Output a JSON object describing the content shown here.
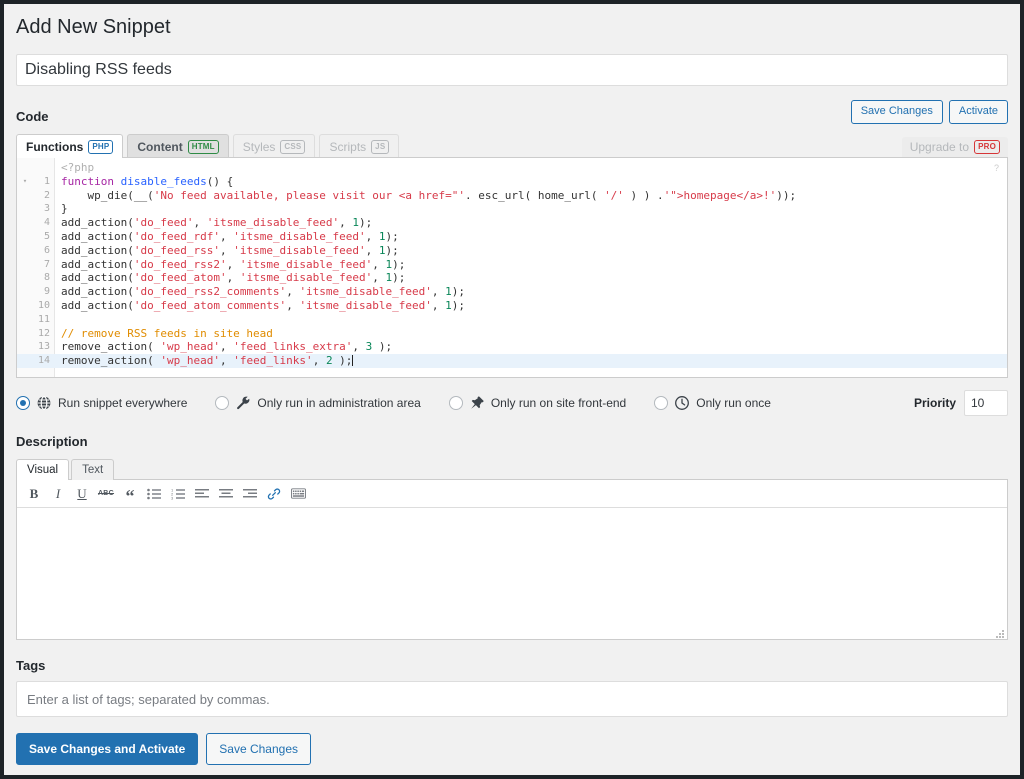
{
  "page": {
    "heading": "Add New Snippet",
    "title_value": "Disabling RSS feeds"
  },
  "code_section": {
    "label": "Code",
    "save_changes_label": "Save Changes",
    "activate_label": "Activate",
    "upgrade_label": "Upgrade to",
    "upgrade_badge": "PRO",
    "help_marker": "?",
    "tabs": [
      {
        "label": "Functions",
        "badge": "PHP",
        "state": "active"
      },
      {
        "label": "Content",
        "badge": "HTML",
        "state": "mid"
      },
      {
        "label": "Styles",
        "badge": "CSS",
        "state": "dim"
      },
      {
        "label": "Scripts",
        "badge": "JS",
        "state": "dim"
      }
    ],
    "php_open_tag": "<?php",
    "lines": [
      {
        "n": 1,
        "fold": "▾",
        "active": false,
        "tokens": [
          {
            "t": "function",
            "c": "kw"
          },
          {
            "t": " ",
            "c": "plain"
          },
          {
            "t": "disable_feeds",
            "c": "fn"
          },
          {
            "t": "() {",
            "c": "plain"
          }
        ]
      },
      {
        "n": 2,
        "fold": "",
        "active": false,
        "tokens": [
          {
            "t": "    wp_die(__(",
            "c": "plain"
          },
          {
            "t": "'No feed available, please visit our <a href=\"'",
            "c": "str"
          },
          {
            "t": ". esc_url( home_url( ",
            "c": "plain"
          },
          {
            "t": "'/'",
            "c": "str"
          },
          {
            "t": " ) ) .",
            "c": "plain"
          },
          {
            "t": "'\">homepage</a>!'",
            "c": "str"
          },
          {
            "t": "));",
            "c": "plain"
          }
        ]
      },
      {
        "n": 3,
        "fold": "",
        "active": false,
        "tokens": [
          {
            "t": "}",
            "c": "plain"
          }
        ]
      },
      {
        "n": 4,
        "fold": "",
        "active": false,
        "tokens": [
          {
            "t": "add_action(",
            "c": "plain"
          },
          {
            "t": "'do_feed'",
            "c": "str"
          },
          {
            "t": ", ",
            "c": "plain"
          },
          {
            "t": "'itsme_disable_feed'",
            "c": "str"
          },
          {
            "t": ", ",
            "c": "plain"
          },
          {
            "t": "1",
            "c": "num"
          },
          {
            "t": ");",
            "c": "plain"
          }
        ]
      },
      {
        "n": 5,
        "fold": "",
        "active": false,
        "tokens": [
          {
            "t": "add_action(",
            "c": "plain"
          },
          {
            "t": "'do_feed_rdf'",
            "c": "str"
          },
          {
            "t": ", ",
            "c": "plain"
          },
          {
            "t": "'itsme_disable_feed'",
            "c": "str"
          },
          {
            "t": ", ",
            "c": "plain"
          },
          {
            "t": "1",
            "c": "num"
          },
          {
            "t": ");",
            "c": "plain"
          }
        ]
      },
      {
        "n": 6,
        "fold": "",
        "active": false,
        "tokens": [
          {
            "t": "add_action(",
            "c": "plain"
          },
          {
            "t": "'do_feed_rss'",
            "c": "str"
          },
          {
            "t": ", ",
            "c": "plain"
          },
          {
            "t": "'itsme_disable_feed'",
            "c": "str"
          },
          {
            "t": ", ",
            "c": "plain"
          },
          {
            "t": "1",
            "c": "num"
          },
          {
            "t": ");",
            "c": "plain"
          }
        ]
      },
      {
        "n": 7,
        "fold": "",
        "active": false,
        "tokens": [
          {
            "t": "add_action(",
            "c": "plain"
          },
          {
            "t": "'do_feed_rss2'",
            "c": "str"
          },
          {
            "t": ", ",
            "c": "plain"
          },
          {
            "t": "'itsme_disable_feed'",
            "c": "str"
          },
          {
            "t": ", ",
            "c": "plain"
          },
          {
            "t": "1",
            "c": "num"
          },
          {
            "t": ");",
            "c": "plain"
          }
        ]
      },
      {
        "n": 8,
        "fold": "",
        "active": false,
        "tokens": [
          {
            "t": "add_action(",
            "c": "plain"
          },
          {
            "t": "'do_feed_atom'",
            "c": "str"
          },
          {
            "t": ", ",
            "c": "plain"
          },
          {
            "t": "'itsme_disable_feed'",
            "c": "str"
          },
          {
            "t": ", ",
            "c": "plain"
          },
          {
            "t": "1",
            "c": "num"
          },
          {
            "t": ");",
            "c": "plain"
          }
        ]
      },
      {
        "n": 9,
        "fold": "",
        "active": false,
        "tokens": [
          {
            "t": "add_action(",
            "c": "plain"
          },
          {
            "t": "'do_feed_rss2_comments'",
            "c": "str"
          },
          {
            "t": ", ",
            "c": "plain"
          },
          {
            "t": "'itsme_disable_feed'",
            "c": "str"
          },
          {
            "t": ", ",
            "c": "plain"
          },
          {
            "t": "1",
            "c": "num"
          },
          {
            "t": ");",
            "c": "plain"
          }
        ]
      },
      {
        "n": 10,
        "fold": "",
        "active": false,
        "tokens": [
          {
            "t": "add_action(",
            "c": "plain"
          },
          {
            "t": "'do_feed_atom_comments'",
            "c": "str"
          },
          {
            "t": ", ",
            "c": "plain"
          },
          {
            "t": "'itsme_disable_feed'",
            "c": "str"
          },
          {
            "t": ", ",
            "c": "plain"
          },
          {
            "t": "1",
            "c": "num"
          },
          {
            "t": ");",
            "c": "plain"
          }
        ]
      },
      {
        "n": 11,
        "fold": "",
        "active": false,
        "tokens": [
          {
            "t": "",
            "c": "plain"
          }
        ]
      },
      {
        "n": 12,
        "fold": "",
        "active": false,
        "tokens": [
          {
            "t": "// remove RSS feeds in site head",
            "c": "com"
          }
        ]
      },
      {
        "n": 13,
        "fold": "",
        "active": false,
        "tokens": [
          {
            "t": "remove_action( ",
            "c": "plain"
          },
          {
            "t": "'wp_head'",
            "c": "str"
          },
          {
            "t": ", ",
            "c": "plain"
          },
          {
            "t": "'feed_links_extra'",
            "c": "str"
          },
          {
            "t": ", ",
            "c": "plain"
          },
          {
            "t": "3",
            "c": "num"
          },
          {
            "t": " );",
            "c": "plain"
          }
        ]
      },
      {
        "n": 14,
        "fold": "",
        "active": true,
        "tokens": [
          {
            "t": "remove_action( ",
            "c": "plain"
          },
          {
            "t": "'wp_head'",
            "c": "str"
          },
          {
            "t": ", ",
            "c": "plain"
          },
          {
            "t": "'feed_links'",
            "c": "str"
          },
          {
            "t": ", ",
            "c": "plain"
          },
          {
            "t": "2",
            "c": "num"
          },
          {
            "t": " );",
            "c": "plain"
          }
        ]
      }
    ]
  },
  "scope": {
    "options": [
      {
        "label": "Run snippet everywhere",
        "icon": "globe-icon",
        "selected": true
      },
      {
        "label": "Only run in administration area",
        "icon": "wrench-icon",
        "selected": false
      },
      {
        "label": "Only run on site front-end",
        "icon": "pin-icon",
        "selected": false
      },
      {
        "label": "Only run once",
        "icon": "clock-icon",
        "selected": false
      }
    ],
    "priority_label": "Priority",
    "priority_value": "10"
  },
  "description": {
    "label": "Description",
    "tabs": [
      {
        "label": "Visual",
        "active": true
      },
      {
        "label": "Text",
        "active": false
      }
    ],
    "toolbar": [
      {
        "name": "bold-icon",
        "glyph": "B"
      },
      {
        "name": "italic-icon",
        "glyph": "I"
      },
      {
        "name": "underline-icon",
        "glyph": "U"
      },
      {
        "name": "strikethrough-icon",
        "glyph": "ABC"
      },
      {
        "name": "blockquote-icon",
        "glyph": "“"
      },
      {
        "name": "bulleted-list-icon",
        "glyph": "list"
      },
      {
        "name": "numbered-list-icon",
        "glyph": "olist"
      },
      {
        "name": "align-left-icon",
        "glyph": "alignl"
      },
      {
        "name": "align-center-icon",
        "glyph": "alignc"
      },
      {
        "name": "align-right-icon",
        "glyph": "alignr"
      },
      {
        "name": "link-icon",
        "glyph": "link"
      },
      {
        "name": "keyboard-shortcuts-icon",
        "glyph": "kbd"
      }
    ],
    "body_value": ""
  },
  "tags": {
    "label": "Tags",
    "placeholder": "Enter a list of tags; separated by commas.",
    "value": ""
  },
  "footer": {
    "primary_label": "Save Changes and Activate",
    "secondary_label": "Save Changes"
  },
  "colors": {
    "accent": "#2271b1",
    "php_badge": "#2271b1",
    "html_badge": "#2e8b45",
    "pro_badge": "#d63638",
    "active_line": "#e8f2fb"
  }
}
